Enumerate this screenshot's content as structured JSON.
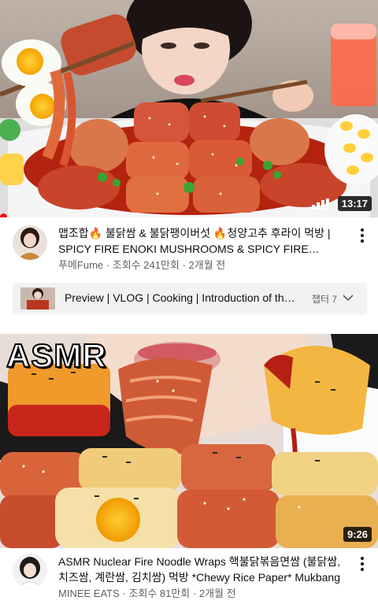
{
  "videos": [
    {
      "title": "맵조합🔥 불닭쌈 & 불닭팽이버섯 🔥청양고추 후라이 먹방 | SPICY FIRE ENOKI MUSHROOMS & SPICY FIRE CHICKEN",
      "channel": "푸메Fume",
      "views": "조회수 241만회",
      "age": "2개월 전",
      "duration": "13:17",
      "progress": 0.0
    },
    {
      "title": "ASMR Nuclear Fire Noodle Wraps 핵불닭볶음면쌈 (불닭쌈, 치즈쌈, 계란쌈, 김치쌈) 먹방 *Chewy Rice Paper* Mukbang",
      "channel": "MINEE EATS",
      "views": "조회수 81만회",
      "age": "2개월 전",
      "duration": "9:26",
      "overlay_text": "ASMR"
    }
  ],
  "chapters": {
    "text": "Preview | VLOG | Cooking | Introduction of the dish",
    "count": "챕터 7"
  },
  "separator": "·",
  "icons": {
    "more": "more-vert-icon",
    "chevron": "chevron-down-icon",
    "sound": "signal-bars-icon"
  },
  "colors": {
    "progress": "#ff0000",
    "secondary_text": "#606060"
  }
}
